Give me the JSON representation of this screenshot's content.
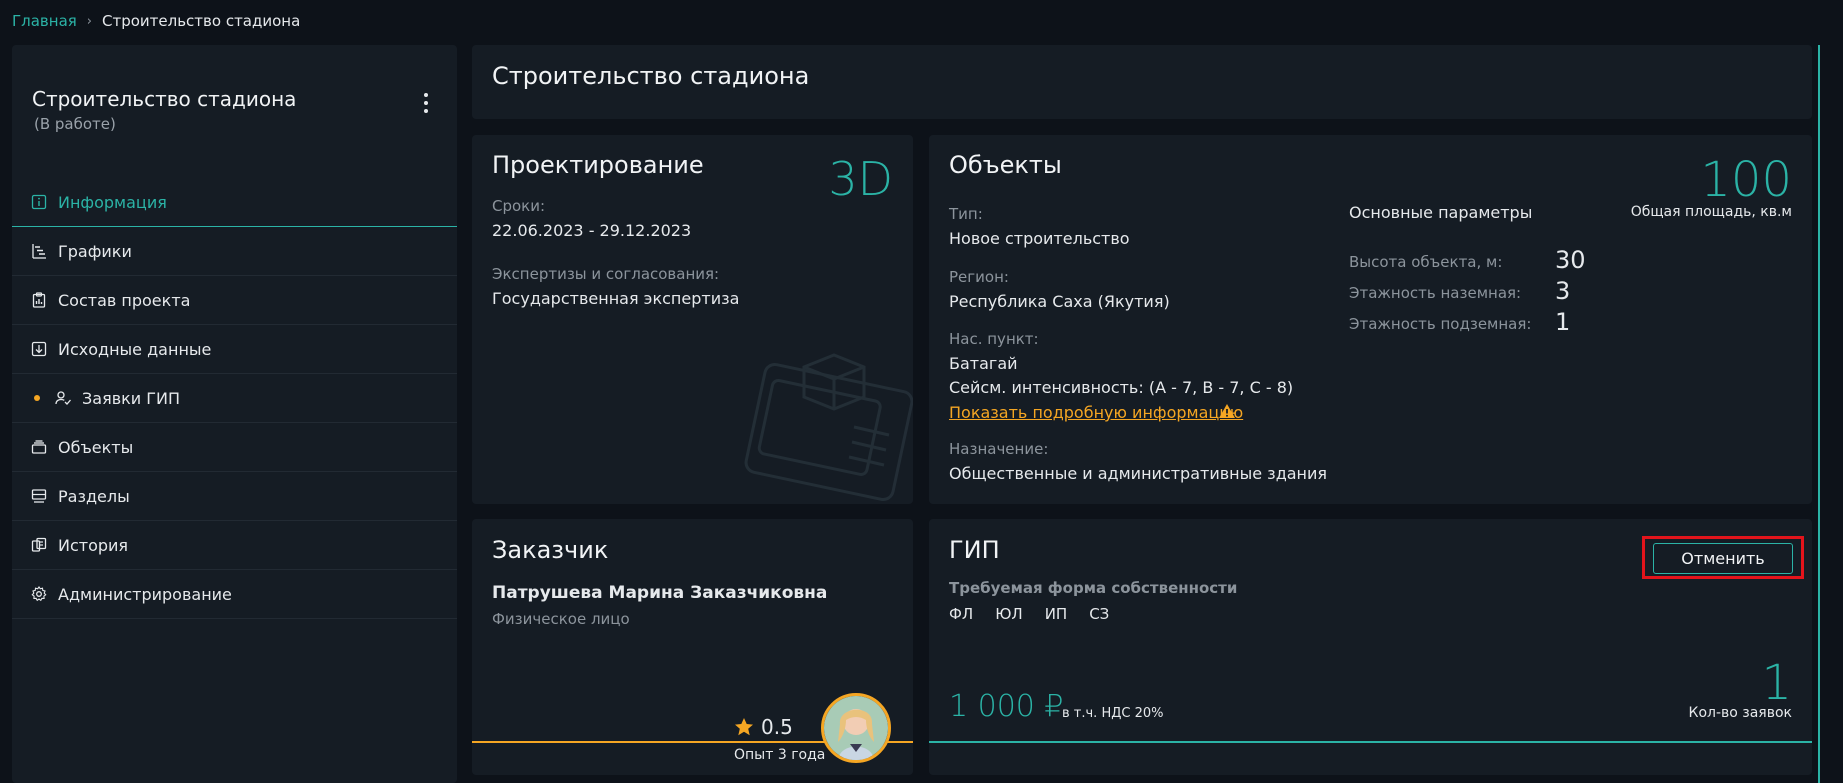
{
  "breadcrumb": {
    "home": "Главная",
    "separator": "›",
    "current": "Строительство стадиона"
  },
  "sidebar": {
    "project_title": "Строительство стадиона",
    "project_status": "(В работе)",
    "items": [
      {
        "label": "Информация",
        "icon": "info-icon"
      },
      {
        "label": "Графики",
        "icon": "gantt-icon"
      },
      {
        "label": "Состав проекта",
        "icon": "clipboard-chart-icon"
      },
      {
        "label": "Исходные данные",
        "icon": "download-box-icon"
      },
      {
        "label": "Заявки ГИП",
        "icon": "user-check-icon"
      },
      {
        "label": "Объекты",
        "icon": "stack-icon"
      },
      {
        "label": "Разделы",
        "icon": "sections-icon"
      },
      {
        "label": "История",
        "icon": "history-icon"
      },
      {
        "label": "Администрирование",
        "icon": "gear-icon"
      }
    ]
  },
  "header": {
    "title": "Строительство стадиона"
  },
  "design": {
    "title": "Проектирование",
    "badge": "3D",
    "dates_label": "Сроки:",
    "dates_value": "22.06.2023 - 29.12.2023",
    "expertise_label": "Экспертизы и согласования:",
    "expertise_value": "Государственная экспертиза"
  },
  "objects": {
    "title": "Объекты",
    "type_label": "Тип:",
    "type_value": "Новое строительство",
    "region_label": "Регион:",
    "region_value": "Республика Саха (Якутия)",
    "locality_label": "Нас. пункт:",
    "locality_value": "Батагай",
    "seismic": "Сейсм. интенсивность: (A - 7, B - 7, C - 8)",
    "details_link": "Показать подробную информацию",
    "purpose_label": "Назначение:",
    "purpose_value": "Общественные и административные здания",
    "params_title": "Основные параметры",
    "area_value": "100",
    "area_label": "Общая площадь, кв.м",
    "params": [
      {
        "label": "Высота объекта, м:",
        "value": "30"
      },
      {
        "label": "Этажность наземная:",
        "value": "3"
      },
      {
        "label": "Этажность подземная:",
        "value": "1"
      }
    ]
  },
  "customer": {
    "title": "Заказчик",
    "name": "Патрушева Марина Заказчиковна",
    "type": "Физическое лицо",
    "rating": "0.5",
    "experience": "Опыт 3 года"
  },
  "gip": {
    "title": "ГИП",
    "cancel_label": "Отменить",
    "ownership_label": "Требуемая форма собственности",
    "ownership_forms": [
      "ФЛ",
      "ЮЛ",
      "ИП",
      "СЗ"
    ],
    "price": "1 000 ₽",
    "vat": "в т.ч. НДС 20%",
    "requests_count": "1",
    "requests_label": "Кол-во заявок"
  },
  "colors": {
    "accent": "#2bb3a6",
    "warning": "#f5a623",
    "highlight": "#e3141b",
    "background": "#0d1219",
    "card": "#151c24"
  }
}
